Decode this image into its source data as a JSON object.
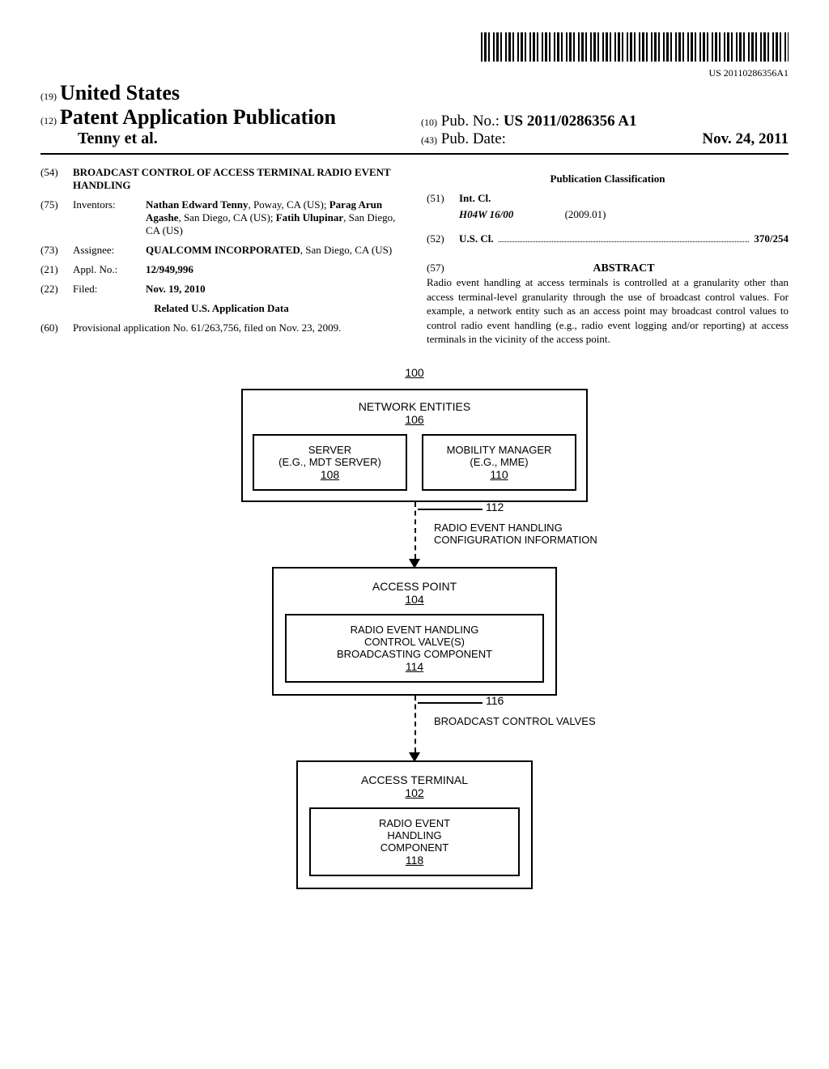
{
  "barcode_number": "US 20110286356A1",
  "header": {
    "code19": "(19)",
    "country": "United States",
    "code12": "(12)",
    "pub_type": "Patent Application Publication",
    "authors_line": "Tenny et al.",
    "code10": "(10)",
    "pub_no_label": "Pub. No.:",
    "pub_no_value": "US 2011/0286356 A1",
    "code43": "(43)",
    "pub_date_label": "Pub. Date:",
    "pub_date_value": "Nov. 24, 2011"
  },
  "left_col": {
    "code54": "(54)",
    "title": "BROADCAST CONTROL OF ACCESS TERMINAL RADIO EVENT HANDLING",
    "code75": "(75)",
    "inventors_label": "Inventors:",
    "inventors_value": "Nathan Edward Tenny, Poway, CA (US); Parag Arun Agashe, San Diego, CA (US); Fatih Ulupinar, San Diego, CA (US)",
    "inventor1": "Nathan Edward Tenny",
    "inventor1_loc": ", Poway, CA (US); ",
    "inventor2": "Parag Arun Agashe",
    "inventor2_loc": ", San Diego, CA (US); ",
    "inventor3": "Fatih Ulupinar",
    "inventor3_loc": ", San Diego, CA (US)",
    "code73": "(73)",
    "assignee_label": "Assignee:",
    "assignee_name": "QUALCOMM INCORPORATED",
    "assignee_loc": ", San Diego, CA (US)",
    "code21": "(21)",
    "appl_no_label": "Appl. No.:",
    "appl_no_value": "12/949,996",
    "code22": "(22)",
    "filed_label": "Filed:",
    "filed_value": "Nov. 19, 2010",
    "related_heading": "Related U.S. Application Data",
    "code60": "(60)",
    "provisional": "Provisional application No. 61/263,756, filed on Nov. 23, 2009."
  },
  "right_col": {
    "classification_heading": "Publication Classification",
    "code51": "(51)",
    "int_cl_label": "Int. Cl.",
    "int_cl_value": "H04W 16/00",
    "int_cl_date": "(2009.01)",
    "code52": "(52)",
    "us_cl_label": "U.S. Cl.",
    "us_cl_value": "370/254",
    "code57": "(57)",
    "abstract_label": "ABSTRACT",
    "abstract_text": "Radio event handling at access terminals is controlled at a granularity other than access terminal-level granularity through the use of broadcast control values. For example, a network entity such as an access point may broadcast control values to control radio event handling (e.g., radio event logging and/or reporting) at access terminals in the vicinity of the access point."
  },
  "figure": {
    "fig_num": "100",
    "network_entities": "NETWORK ENTITIES",
    "ref106": "106",
    "server_line1": "SERVER",
    "server_line2": "(E.G., MDT SERVER)",
    "ref108": "108",
    "mobility_line1": "MOBILITY MANAGER",
    "mobility_line2": "(E.G., MME)",
    "ref110": "110",
    "ref112": "112",
    "arrow1_label": "RADIO EVENT HANDLING CONFIGURATION INFORMATION",
    "access_point": "ACCESS POINT",
    "ref104": "104",
    "ap_inner_line1": "RADIO EVENT HANDLING",
    "ap_inner_line2": "CONTROL VALVE(S)",
    "ap_inner_line3": "BROADCASTING COMPONENT",
    "ref114": "114",
    "ref116": "116",
    "arrow2_label": "BROADCAST CONTROL VALVES",
    "access_terminal": "ACCESS TERMINAL",
    "ref102": "102",
    "at_inner_line1": "RADIO EVENT",
    "at_inner_line2": "HANDLING",
    "at_inner_line3": "COMPONENT",
    "ref118": "118"
  }
}
